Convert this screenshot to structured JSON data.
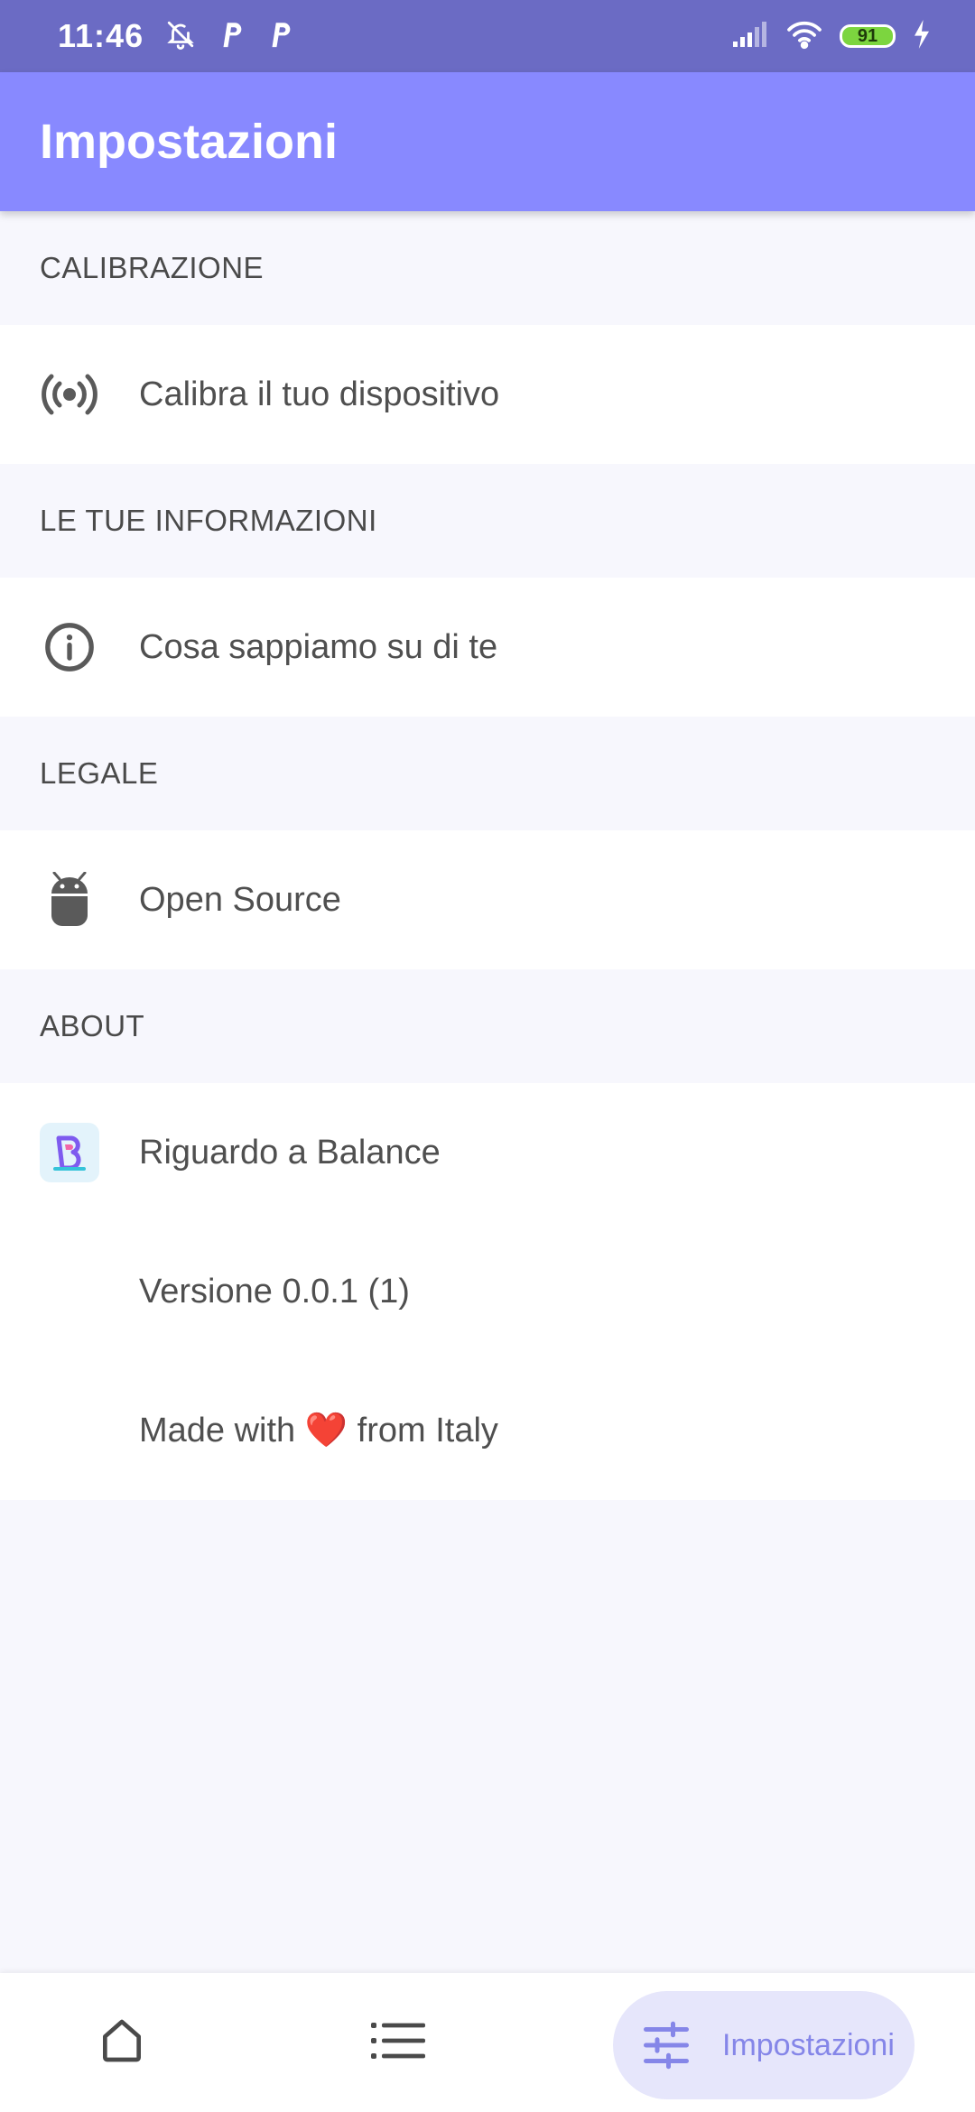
{
  "status_bar": {
    "time": "11:46",
    "battery_level": "91",
    "icons": [
      "bell-off-icon",
      "parking-p-icon",
      "parking-p-icon",
      "signal-icon",
      "wifi-icon",
      "battery-icon",
      "charging-icon"
    ]
  },
  "app_bar": {
    "title": "Impostazioni"
  },
  "sections": {
    "calibration": {
      "header": "CALIBRAZIONE",
      "item_label": "Calibra il tuo dispositivo",
      "item_icon": "radar-broadcast-icon"
    },
    "info": {
      "header": "LE TUE INFORMAZIONI",
      "item_label": "Cosa sappiamo su di te",
      "item_icon": "info-icon"
    },
    "legal": {
      "header": "LEGALE",
      "item_label": "Open Source",
      "item_icon": "android-icon"
    },
    "about": {
      "header": "ABOUT",
      "about_label": "Riguardo a Balance",
      "about_icon": "balance-logo-icon",
      "version_label": "Versione 0.0.1 (1)",
      "made_with_prefix": "Made with",
      "made_with_heart": "❤️",
      "made_with_suffix": "from Italy"
    }
  },
  "bottom_nav": {
    "home_icon": "home-icon",
    "list_icon": "list-icon",
    "settings_icon": "sliders-icon",
    "settings_label": "Impostazioni"
  },
  "colors": {
    "status_bar": "#6B6BC4",
    "app_bar": "#8889FF",
    "accent": "#8586E8",
    "nav_pill": "#E6E6FB",
    "background": "#F7F7FD"
  }
}
